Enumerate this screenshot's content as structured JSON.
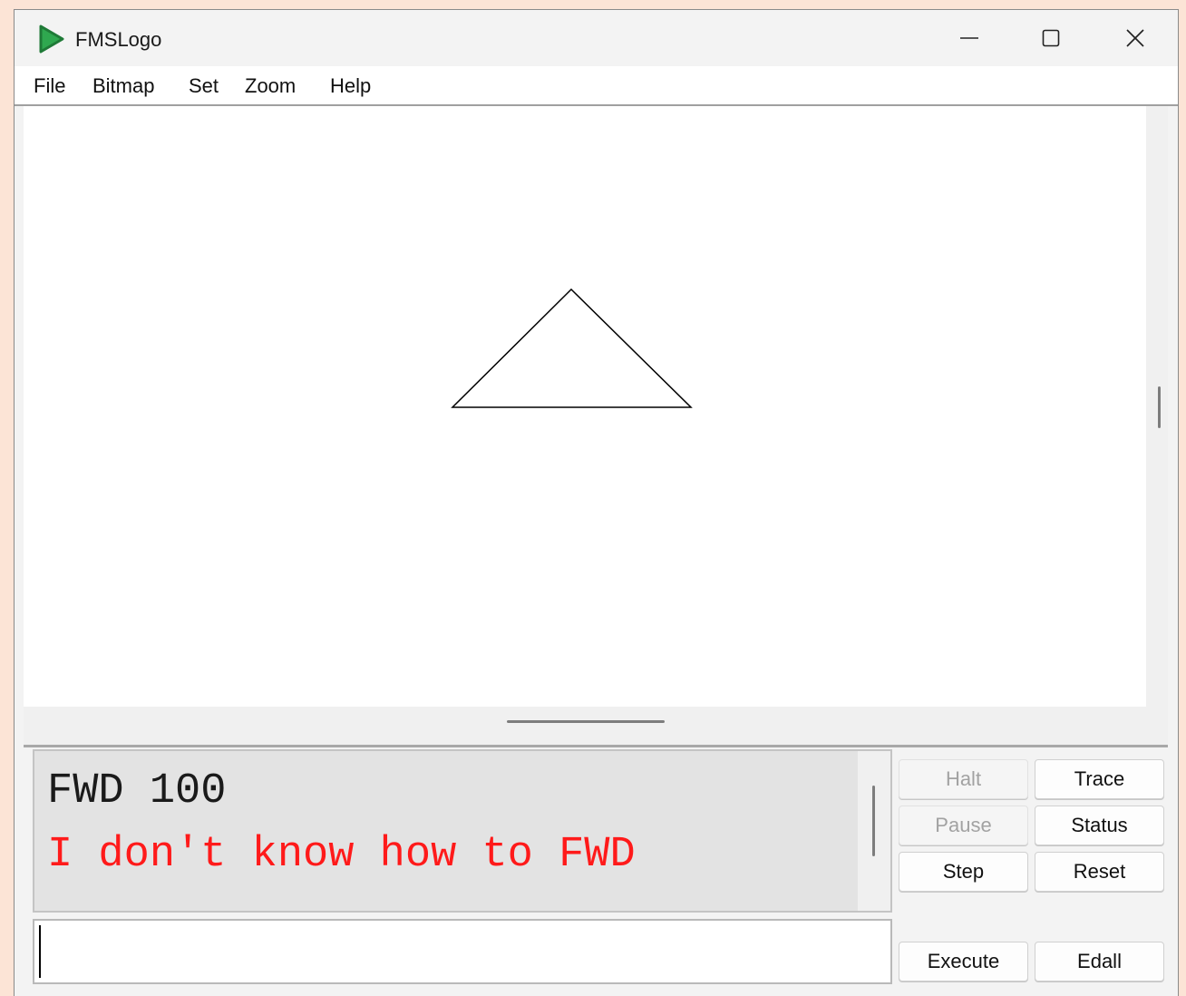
{
  "window": {
    "title": "FMSLogo"
  },
  "menu": [
    "File",
    "Bitmap",
    "Set",
    "Zoom",
    "Help"
  ],
  "commander": {
    "history": [
      {
        "text": "FWD 100",
        "color": "#1a1a1a"
      },
      {
        "text": "I don't know how to FWD",
        "color": "#ff1a1a"
      }
    ],
    "input_value": ""
  },
  "buttons": {
    "halt": "Halt",
    "trace": "Trace",
    "pause": "Pause",
    "status": "Status",
    "step": "Step",
    "reset": "Reset",
    "execute": "Execute",
    "edall": "Edall"
  },
  "icons": {
    "app": "play-triangle-icon",
    "minimize": "minimize-icon",
    "maximize": "maximize-icon",
    "close": "close-icon"
  },
  "colors": {
    "app_icon": "#2fa84f",
    "error_text": "#ff1a1a",
    "background": "#fce4d6"
  }
}
